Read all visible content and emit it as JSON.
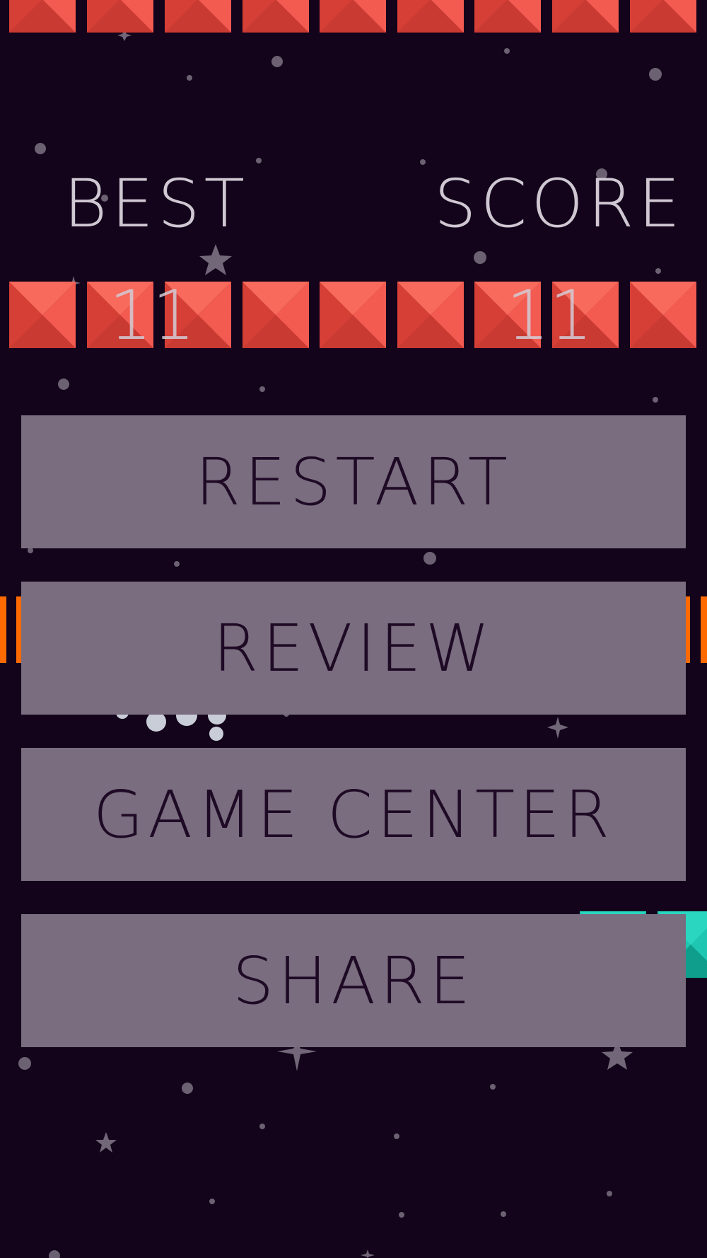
{
  "scores": {
    "best_label": "BEST",
    "best_value": "11",
    "score_label": "SCORE",
    "score_value": "11"
  },
  "menu": {
    "restart_label": "RESTART",
    "review_label": "REVIEW",
    "game_center_label": "GAME CENTER",
    "share_label": "SHARE"
  },
  "colors": {
    "background": "#13031b",
    "block_red": "#f2483d",
    "button_fill": "#7a6d7f",
    "button_text": "#1f0a26",
    "label_text": "#cfc8d2",
    "accent_orange": "#ff6a00",
    "accent_teal": "#1fc6b1"
  },
  "icons": [
    "star-icon",
    "sparkle-icon",
    "ball-icon"
  ]
}
